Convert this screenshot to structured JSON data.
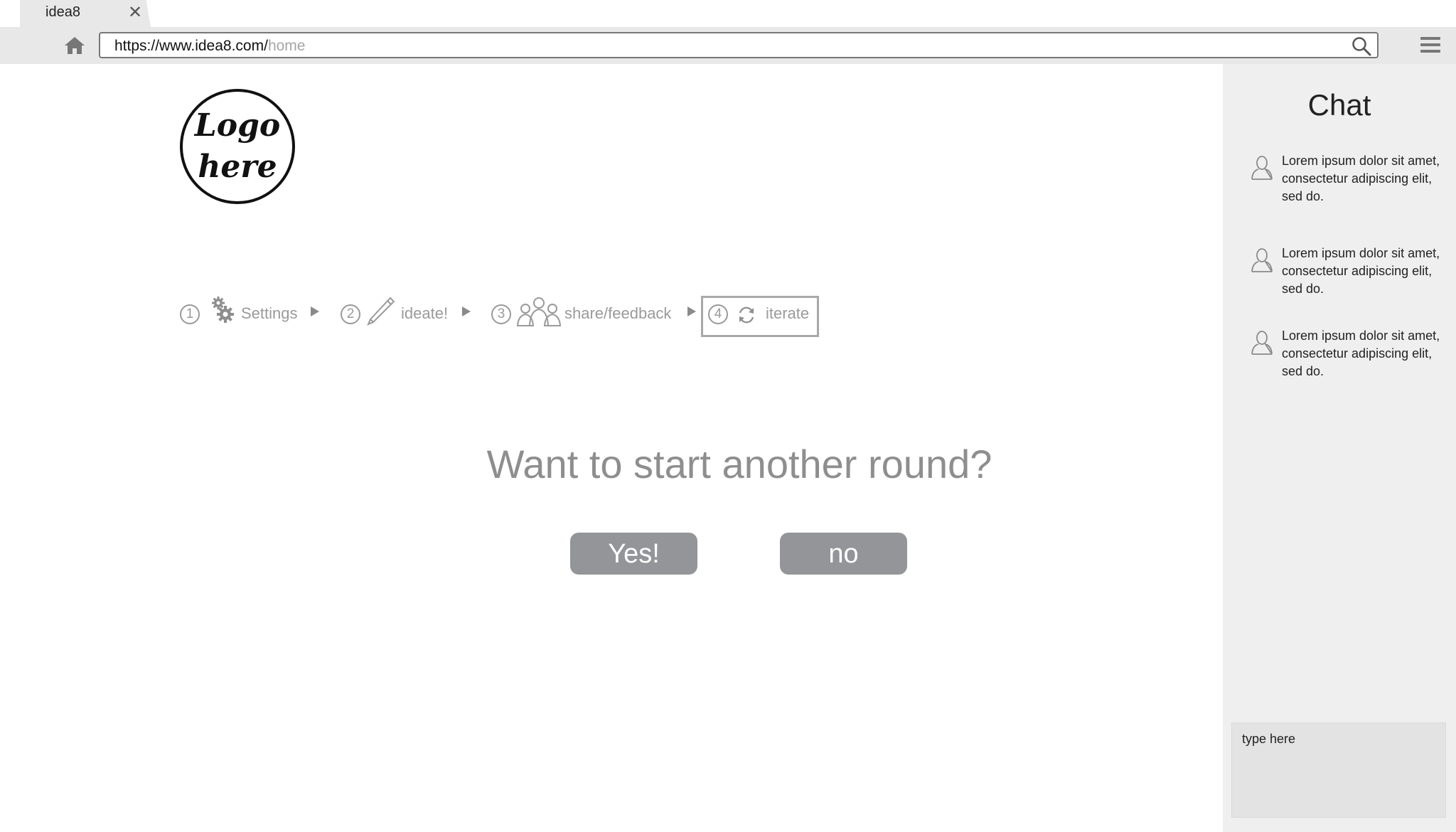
{
  "browser": {
    "tab_title": "idea8",
    "tab_close_icon": "close-icon",
    "url_base": "https://www.idea8.com/",
    "url_path": "home",
    "home_icon": "home-icon",
    "search_icon": "search-icon",
    "menu_icon": "hamburger-menu-icon"
  },
  "logo": {
    "line1": "Logo",
    "line2": "here"
  },
  "steps": [
    {
      "number": "1",
      "label": "Settings",
      "icon": "gears-icon",
      "active": false
    },
    {
      "number": "2",
      "label": "ideate!",
      "icon": "pencil-icon",
      "active": false
    },
    {
      "number": "3",
      "label": "share/feedback",
      "icon": "people-icon",
      "active": false
    },
    {
      "number": "4",
      "label": "iterate",
      "icon": "refresh-icon",
      "active": true
    }
  ],
  "main": {
    "question": "Want to start another round?",
    "yes_label": "Yes!",
    "no_label": "no"
  },
  "chat": {
    "title": "Chat",
    "messages": [
      {
        "text": "Lorem ipsum dolor sit amet,\n consectetur adipiscing elit,\nsed do.",
        "avatar": "user-icon"
      },
      {
        "text": "Lorem ipsum dolor sit amet,\n consectetur adipiscing elit,\nsed do.",
        "avatar": "user-icon"
      },
      {
        "text": "Lorem ipsum dolor sit amet,\n consectetur adipiscing elit,\nsed do.",
        "avatar": "user-icon"
      }
    ],
    "input_placeholder": "type here"
  },
  "colors": {
    "chrome_bg": "#e8e8e8",
    "panel_bg": "#efefef",
    "button_bg": "#939598",
    "muted_text": "#9a9a9a"
  }
}
